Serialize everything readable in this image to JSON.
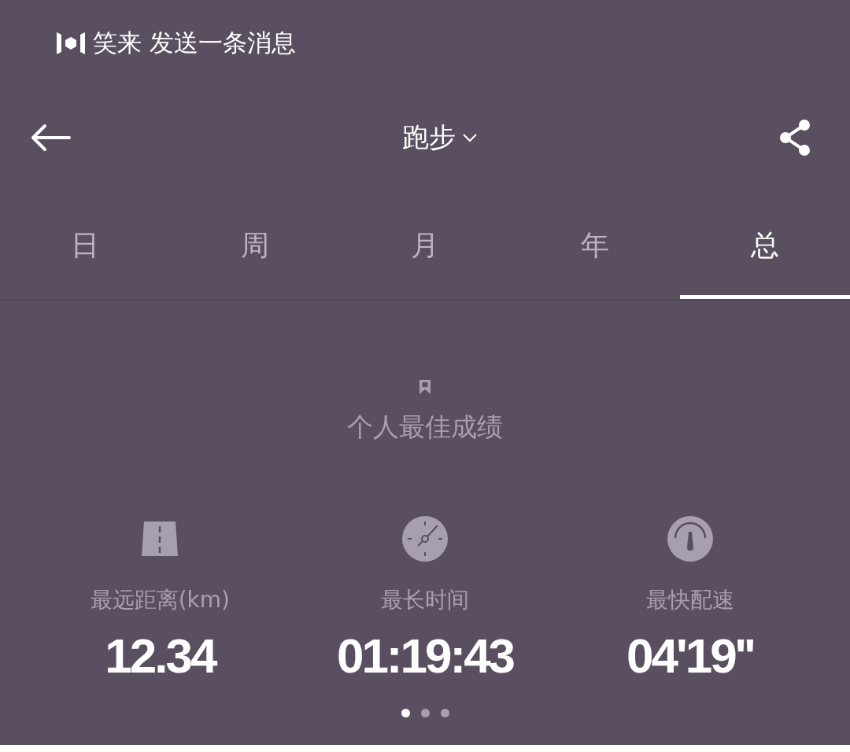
{
  "header": {
    "brand": "笑来 发送一条消息"
  },
  "nav": {
    "title": "跑步"
  },
  "tabs": [
    {
      "label": "日",
      "selected": false
    },
    {
      "label": "周",
      "selected": false
    },
    {
      "label": "月",
      "selected": false
    },
    {
      "label": "年",
      "selected": false
    },
    {
      "label": "总",
      "selected": true
    }
  ],
  "records": {
    "title": "个人最佳成绩",
    "stats": [
      {
        "kind": "road",
        "label": "最远距离(km)",
        "value": "12.34"
      },
      {
        "kind": "clock",
        "label": "最长时间",
        "value": "01:19:43"
      },
      {
        "kind": "gauge",
        "label": "最快配速",
        "value": "04'19''"
      }
    ]
  },
  "pages": [
    {
      "selected": true
    },
    {
      "selected": false
    },
    {
      "selected": false
    }
  ]
}
